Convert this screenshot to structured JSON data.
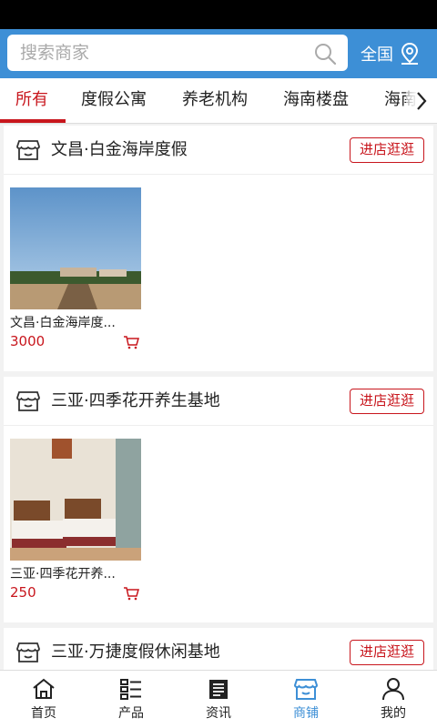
{
  "search": {
    "placeholder": "搜索商家",
    "region_label": "全国"
  },
  "tabs": [
    {
      "label": "所有"
    },
    {
      "label": "度假公寓"
    },
    {
      "label": "养老机构"
    },
    {
      "label": "海南楼盘"
    },
    {
      "label": "海南"
    }
  ],
  "shops": [
    {
      "name": "文昌·白金海岸度假",
      "visit_label": "进店逛逛",
      "product": {
        "name": "文昌·白金海岸度...",
        "price": "3000"
      }
    },
    {
      "name": "三亚·四季花开养生基地",
      "visit_label": "进店逛逛",
      "product": {
        "name": "三亚·四季花开养...",
        "price": "250"
      }
    },
    {
      "name": "三亚·万捷度假休闲基地",
      "visit_label": "进店逛逛"
    }
  ],
  "nav": [
    {
      "label": "首页",
      "icon": "home-icon"
    },
    {
      "label": "产品",
      "icon": "list-icon"
    },
    {
      "label": "资讯",
      "icon": "news-icon"
    },
    {
      "label": "商铺",
      "icon": "shop-icon"
    },
    {
      "label": "我的",
      "icon": "user-icon"
    }
  ],
  "colors": {
    "header": "#3d8fd6",
    "accent": "#c8161d",
    "nav_active": "#3d8fd6"
  }
}
